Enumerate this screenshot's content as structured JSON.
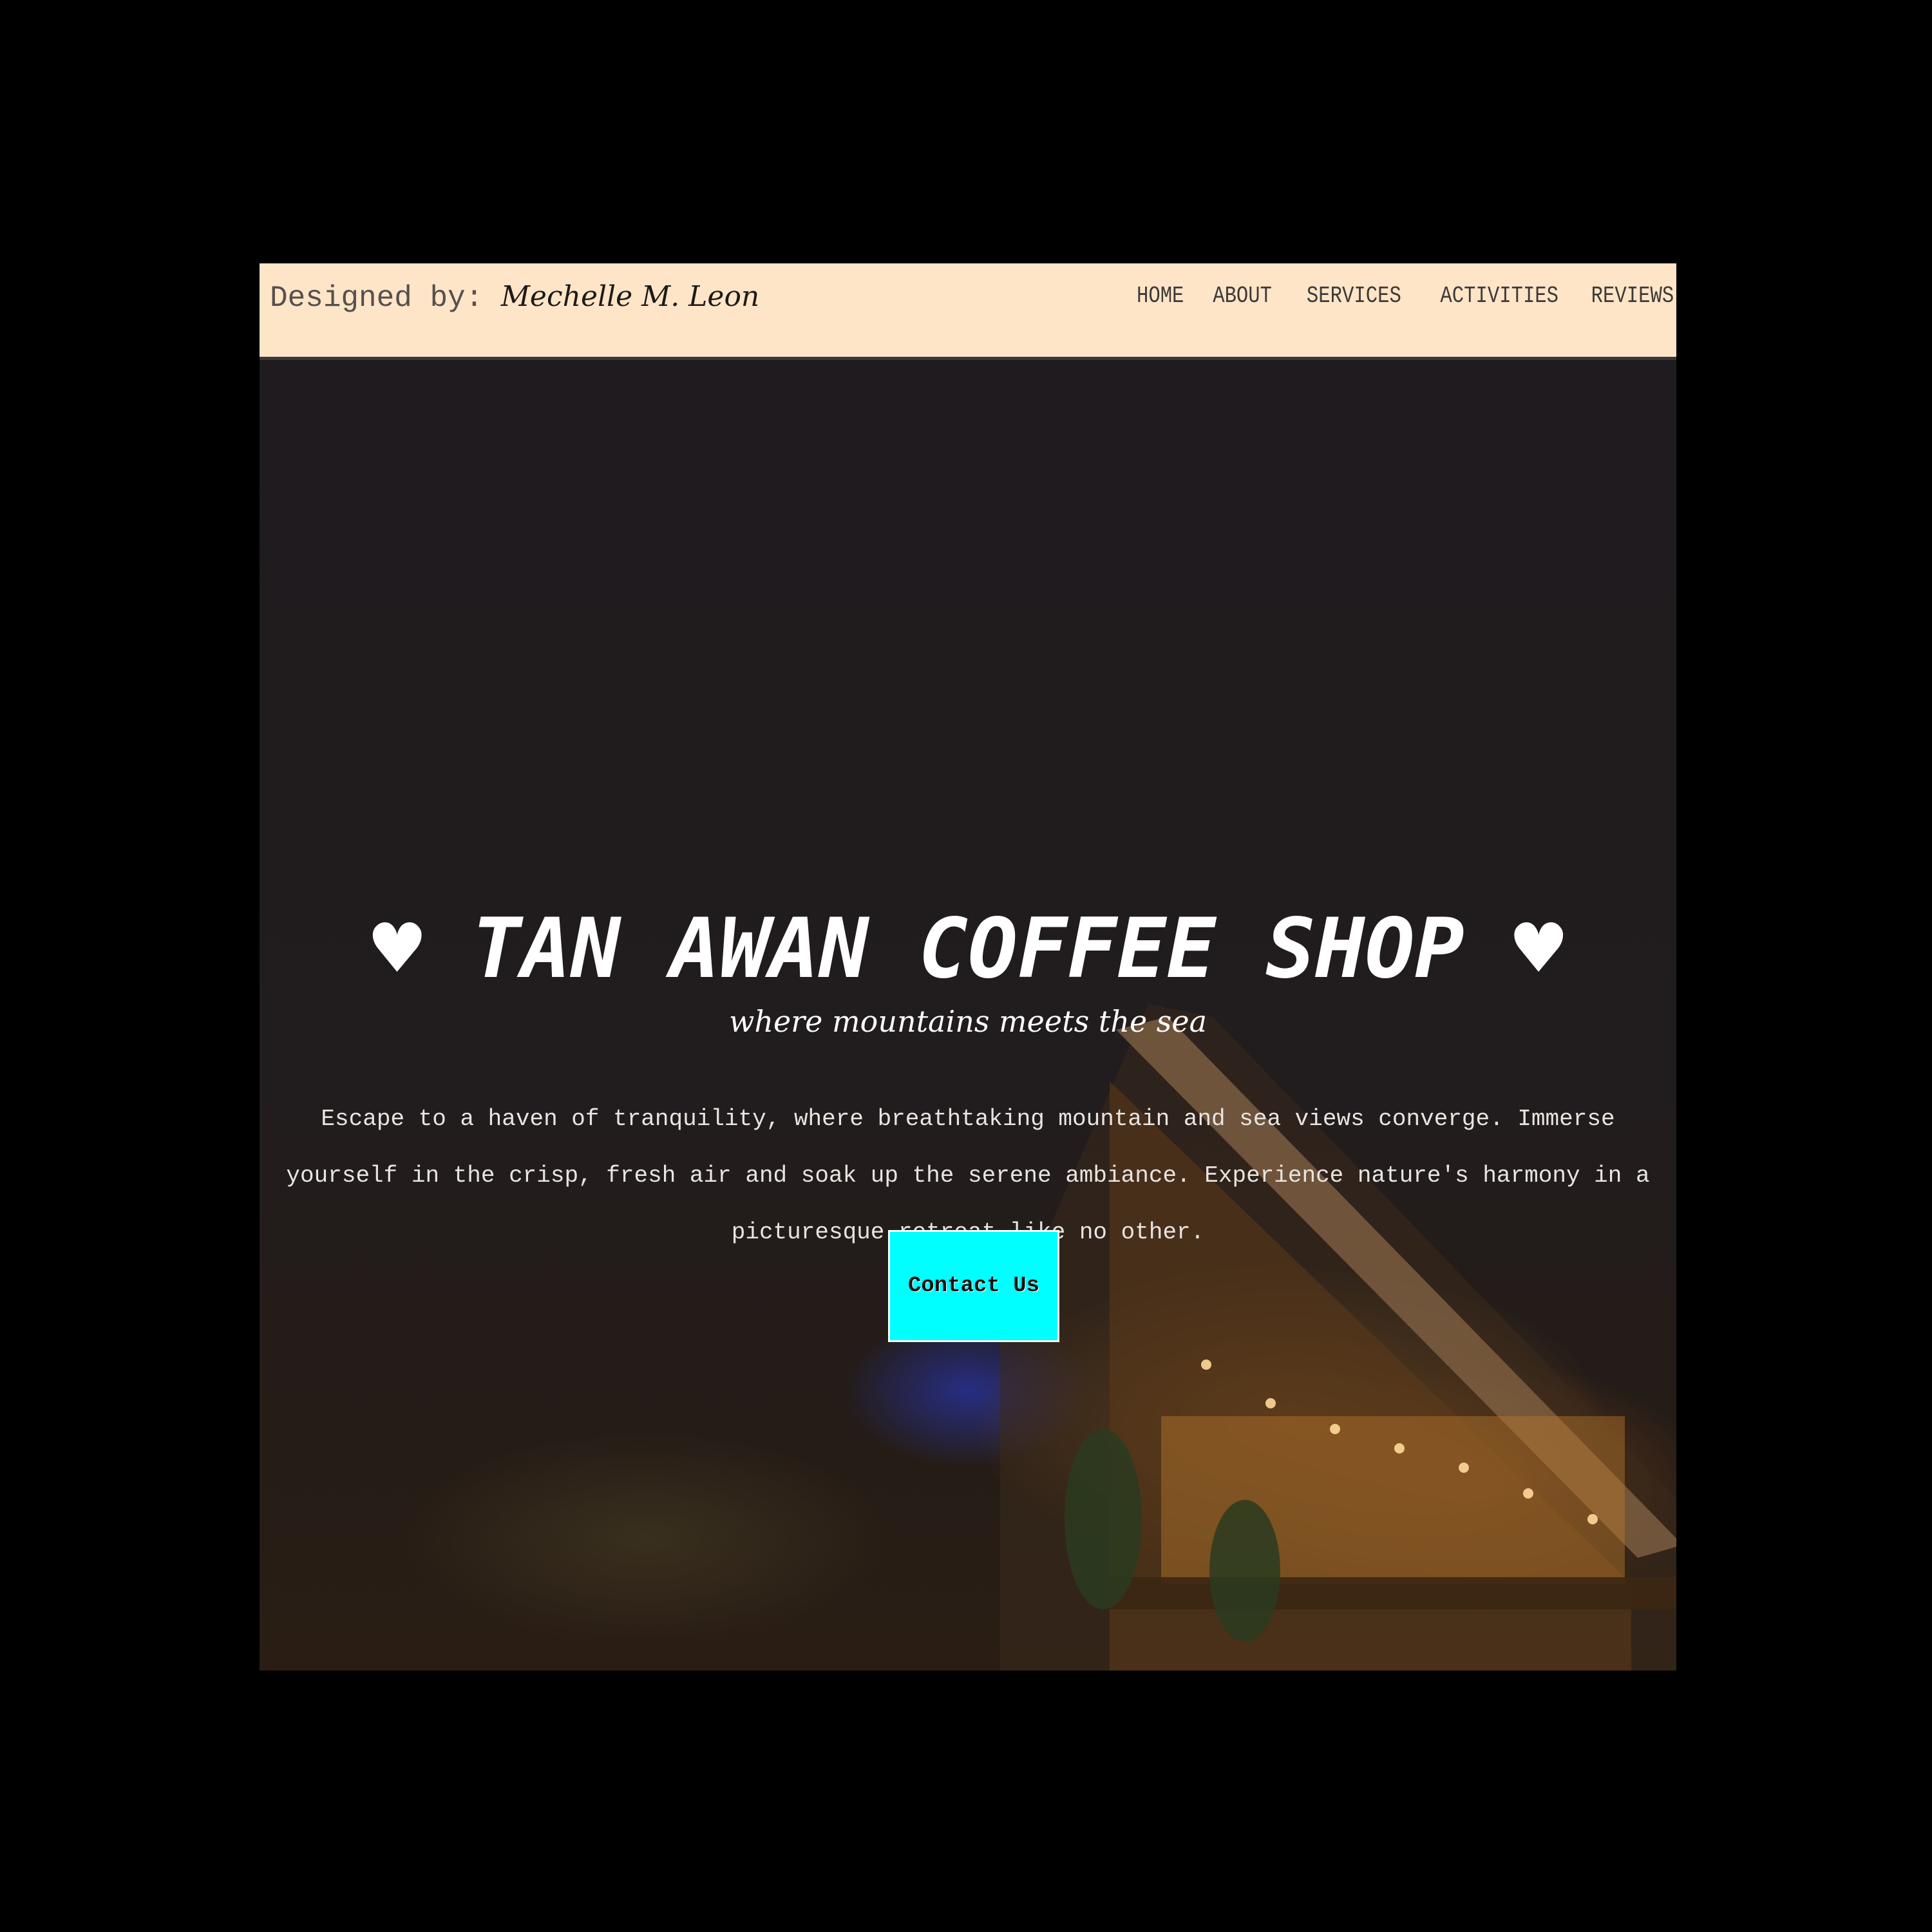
{
  "navbar": {
    "designed_by_label": "Designed by:",
    "designer_name": "Mechelle M. Leon",
    "links": [
      "HOME",
      "ABOUT",
      "SERVICES",
      "ACTIVITIES",
      "REVIEWS"
    ]
  },
  "hero": {
    "heart_left": "♥",
    "title": "TAN AWAN COFFEE SHOP",
    "heart_right": "♥",
    "tagline": "where mountains meets the sea",
    "description": "Escape to a haven of tranquility, where breathtaking mountain and sea views converge. Immerse yourself in the crisp, fresh air and soak up the serene ambiance. Experience nature's harmony in a picturesque retreat like no other.",
    "cta_label": "Contact Us"
  },
  "colors": {
    "navbar_bg": "#ffe5c8",
    "cta_bg": "#00ffff",
    "page_bg": "#000000"
  }
}
